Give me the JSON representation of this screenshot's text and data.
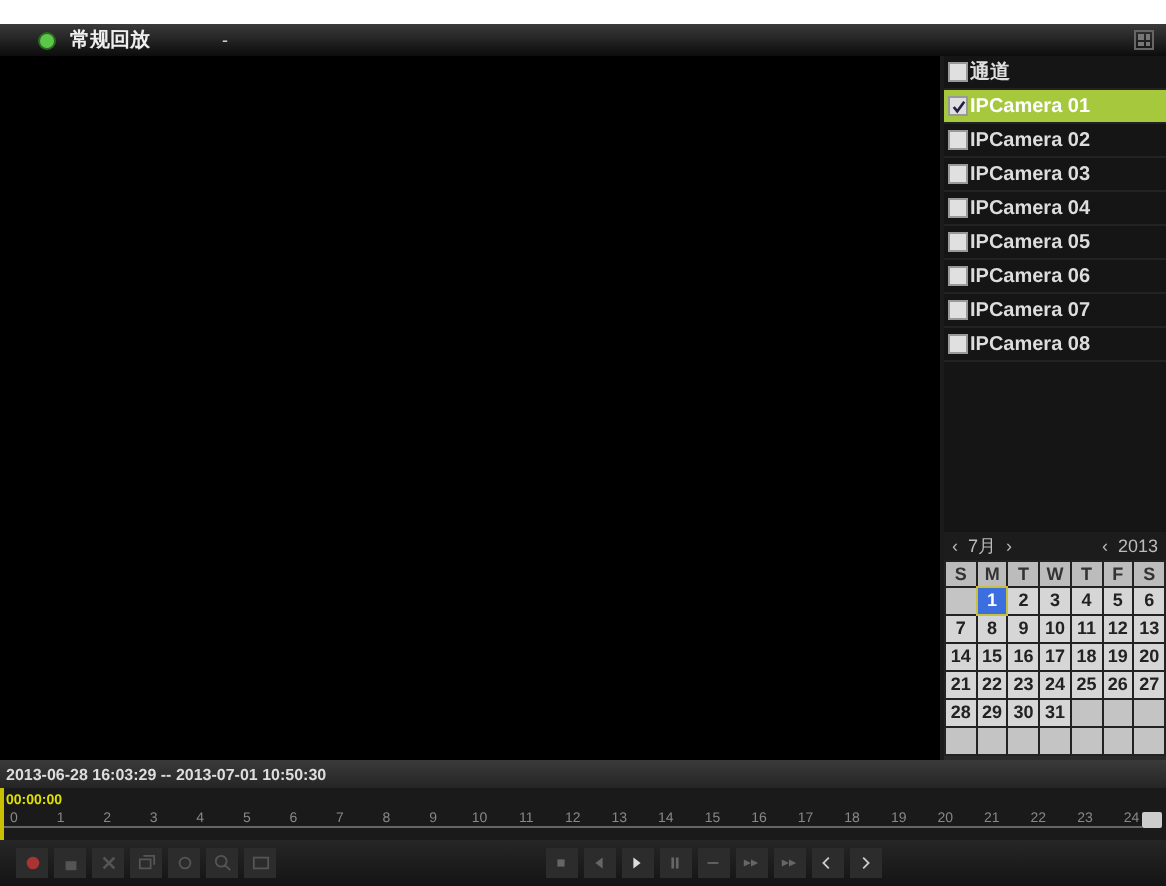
{
  "title_bar": {
    "title": "常规回放",
    "dropdown": "-"
  },
  "channel_list": {
    "header": "通道",
    "header_checked": false,
    "items": [
      {
        "label": "IPCamera 01",
        "checked": true,
        "selected": true
      },
      {
        "label": "IPCamera 02",
        "checked": false,
        "selected": false
      },
      {
        "label": "IPCamera 03",
        "checked": false,
        "selected": false
      },
      {
        "label": "IPCamera 04",
        "checked": false,
        "selected": false
      },
      {
        "label": "IPCamera 05",
        "checked": false,
        "selected": false
      },
      {
        "label": "IPCamera 06",
        "checked": false,
        "selected": false
      },
      {
        "label": "IPCamera 07",
        "checked": false,
        "selected": false
      },
      {
        "label": "IPCamera 08",
        "checked": false,
        "selected": false
      }
    ]
  },
  "calendar": {
    "prev": "‹",
    "month": "7月",
    "next": "›",
    "year_prev": "‹",
    "year": "2013",
    "weekdays": [
      "S",
      "M",
      "T",
      "W",
      "T",
      "F",
      "S"
    ],
    "weeks": [
      [
        {
          "kind": "blank"
        },
        {
          "kind": "day",
          "day": "1",
          "selected": true
        },
        {
          "kind": "day",
          "day": "2",
          "selected": false
        },
        {
          "kind": "day",
          "day": "3",
          "selected": false
        },
        {
          "kind": "day",
          "day": "4",
          "selected": false
        },
        {
          "kind": "day",
          "day": "5",
          "selected": false
        },
        {
          "kind": "day",
          "day": "6",
          "selected": false
        }
      ],
      [
        {
          "kind": "day",
          "day": "7",
          "selected": false
        },
        {
          "kind": "day",
          "day": "8",
          "selected": false
        },
        {
          "kind": "day",
          "day": "9",
          "selected": false
        },
        {
          "kind": "day",
          "day": "10",
          "selected": false
        },
        {
          "kind": "day",
          "day": "11",
          "selected": false
        },
        {
          "kind": "day",
          "day": "12",
          "selected": false
        },
        {
          "kind": "day",
          "day": "13",
          "selected": false
        }
      ],
      [
        {
          "kind": "day",
          "day": "14",
          "selected": false
        },
        {
          "kind": "day",
          "day": "15",
          "selected": false
        },
        {
          "kind": "day",
          "day": "16",
          "selected": false
        },
        {
          "kind": "day",
          "day": "17",
          "selected": false
        },
        {
          "kind": "day",
          "day": "18",
          "selected": false
        },
        {
          "kind": "day",
          "day": "19",
          "selected": false
        },
        {
          "kind": "day",
          "day": "20",
          "selected": false
        }
      ],
      [
        {
          "kind": "day",
          "day": "21",
          "selected": false
        },
        {
          "kind": "day",
          "day": "22",
          "selected": false
        },
        {
          "kind": "day",
          "day": "23",
          "selected": false
        },
        {
          "kind": "day",
          "day": "24",
          "selected": false
        },
        {
          "kind": "day",
          "day": "25",
          "selected": false
        },
        {
          "kind": "day",
          "day": "26",
          "selected": false
        },
        {
          "kind": "day",
          "day": "27",
          "selected": false
        }
      ],
      [
        {
          "kind": "day",
          "day": "28",
          "selected": false
        },
        {
          "kind": "day",
          "day": "29",
          "selected": false
        },
        {
          "kind": "day",
          "day": "30",
          "selected": false
        },
        {
          "kind": "day",
          "day": "31",
          "selected": false
        },
        {
          "kind": "blank"
        },
        {
          "kind": "blank"
        },
        {
          "kind": "blank"
        }
      ],
      [
        {
          "kind": "blank"
        },
        {
          "kind": "blank"
        },
        {
          "kind": "blank"
        },
        {
          "kind": "blank"
        },
        {
          "kind": "blank"
        },
        {
          "kind": "blank"
        },
        {
          "kind": "blank"
        }
      ]
    ]
  },
  "time_range": "2013-06-28 16:03:29 -- 2013-07-01 10:50:30",
  "timeline": {
    "cursor": "00:00:00",
    "ticks": [
      "0",
      "1",
      "2",
      "3",
      "4",
      "5",
      "6",
      "7",
      "8",
      "9",
      "10",
      "11",
      "12",
      "13",
      "14",
      "15",
      "16",
      "17",
      "18",
      "19",
      "20",
      "21",
      "22",
      "23",
      "24"
    ]
  }
}
